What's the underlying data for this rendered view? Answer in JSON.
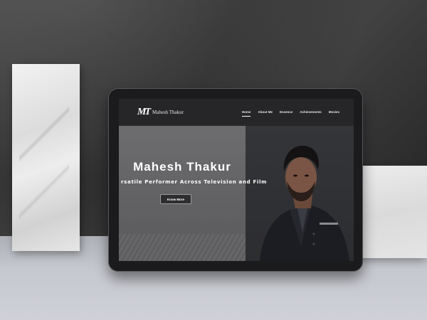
{
  "site": {
    "logo_mark": "MT",
    "logo_name": "Mahesh Thakur"
  },
  "nav": {
    "items": [
      {
        "label": "Home",
        "active": true
      },
      {
        "label": "About Me"
      },
      {
        "label": "Essence"
      },
      {
        "label": "Achievements"
      },
      {
        "label": "Movies"
      }
    ]
  },
  "hero": {
    "title": "Mahesh Thakur",
    "subtitle": "rsatile Performer Across Television and Film",
    "button_label": "Know More"
  },
  "colors": {
    "nav_bg": "#262628",
    "hero_left_bg": "#6d6d6f",
    "hero_right_bg": "#343538",
    "text": "#ffffff"
  }
}
